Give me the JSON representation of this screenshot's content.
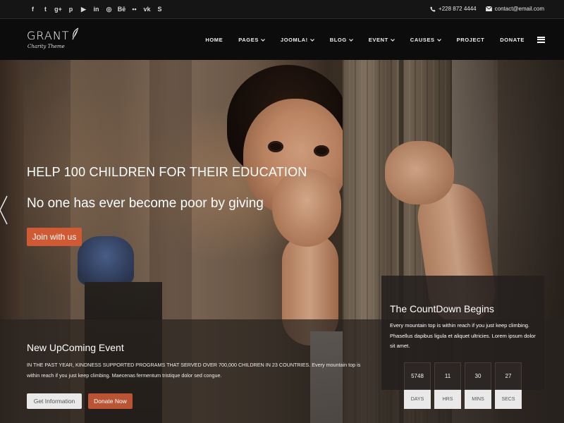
{
  "topbar": {
    "social_icons": [
      {
        "name": "facebook-icon",
        "glyph": "f"
      },
      {
        "name": "twitter-icon",
        "glyph": "t"
      },
      {
        "name": "google-plus-icon",
        "glyph": "g+"
      },
      {
        "name": "pinterest-icon",
        "glyph": "p"
      },
      {
        "name": "youtube-icon",
        "glyph": "▶"
      },
      {
        "name": "linkedin-icon",
        "glyph": "in"
      },
      {
        "name": "dribbble-icon",
        "glyph": "◎"
      },
      {
        "name": "behance-icon",
        "glyph": "Bē"
      },
      {
        "name": "flickr-icon",
        "glyph": "••"
      },
      {
        "name": "vk-icon",
        "glyph": "vk"
      },
      {
        "name": "skype-icon",
        "glyph": "S"
      }
    ],
    "phone": "+228 872 4444",
    "email": "contact@email.com"
  },
  "header": {
    "logo_main": "GRANT",
    "logo_sub": "Charity Theme",
    "nav": [
      {
        "label": "HOME",
        "has_caret": false
      },
      {
        "label": "PAGES",
        "has_caret": true
      },
      {
        "label": "JOOMLA!",
        "has_caret": true
      },
      {
        "label": "BLOG",
        "has_caret": true
      },
      {
        "label": "EVENT",
        "has_caret": true
      },
      {
        "label": "CAUSES",
        "has_caret": true
      },
      {
        "label": "PROJECT",
        "has_caret": false
      },
      {
        "label": "DONATE",
        "has_caret": false
      }
    ]
  },
  "hero": {
    "title": "HELP 100 CHILDREN FOR THEIR EDUCATION",
    "subtitle": "No one has ever become poor by giving",
    "button": "Join with us"
  },
  "event": {
    "title": "New UpComing Event",
    "text": "IN THE PAST YEAR, KINDNESS SUPPORTED PROGRAMS THAT SERVED OVER 700,000 CHILDREN IN 23 COUNTRIES. Every mountain top is within reach if you just keep climbing. Maecenas fermentum tristique dolor sed congue.",
    "info_button": "Get Information",
    "donate_button": "Donate Now"
  },
  "countdown": {
    "title": "The CountDown Begins",
    "text": "Every mountain top is within reach if you just keep climbing. Phasellus dapibus ligula et aliquet ultricies. Lorem ipsum dolor sit amet.",
    "units": [
      {
        "value": "5748",
        "label": "DAYS"
      },
      {
        "value": "11",
        "label": "HRS"
      },
      {
        "value": "30",
        "label": "MINS"
      },
      {
        "value": "27",
        "label": "SECS"
      }
    ]
  },
  "colors": {
    "accent": "#cf5a33",
    "donate": "#bb5434",
    "header_bg": "#0c0c0c",
    "topbar_bg": "#151515"
  }
}
